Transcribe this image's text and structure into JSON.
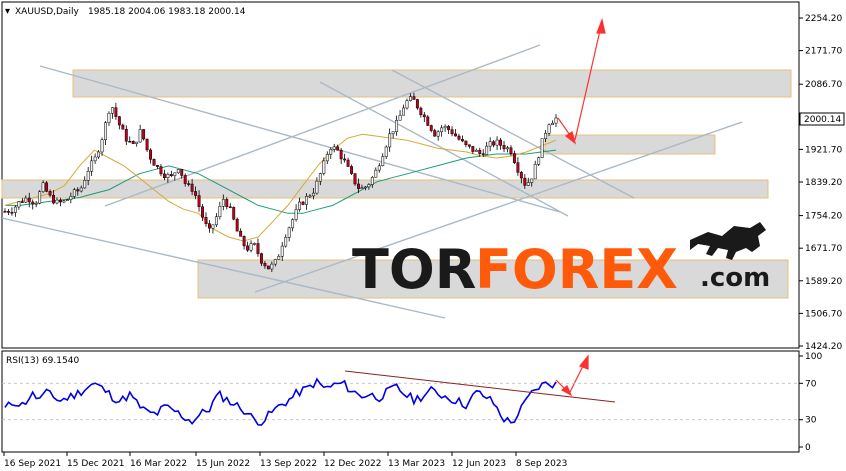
{
  "chart_data": [
    {
      "type": "candlestick",
      "title": "XAUUSD,Daily",
      "ohlc": "1985.18 2004.06 1983.18 2000.14",
      "last_price": "2000.14",
      "y_ticks": [
        "2254.20",
        "2171.70",
        "2086.70",
        "2004.20",
        "1921.70",
        "1839.20",
        "1754.20",
        "1671.70",
        "1589.20",
        "1506.70",
        "1424.20"
      ],
      "ylim": [
        1424.2,
        2254.2
      ],
      "x_ticks": [
        "16 Sep 2021",
        "15 Dec 2021",
        "16 Mar 2022",
        "15 Jun 2022",
        "13 Sep 2022",
        "12 Dec 2022",
        "13 Mar 2023",
        "12 Jun 2023",
        "8 Sep 2023"
      ],
      "path_y": [
        1765,
        1770,
        1790,
        1800,
        1785,
        1830,
        1800,
        1785,
        1790,
        1810,
        1820,
        1870,
        1900,
        1960,
        2040,
        1990,
        1950,
        1930,
        1970,
        1910,
        1880,
        1860,
        1850,
        1880,
        1830,
        1820,
        1760,
        1710,
        1750,
        1800,
        1760,
        1700,
        1670,
        1680,
        1640,
        1620,
        1640,
        1700,
        1740,
        1780,
        1800,
        1820,
        1870,
        1930,
        1920,
        1890,
        1850,
        1820,
        1830,
        1860,
        1910,
        1960,
        1990,
        2040,
        2050,
        2020,
        1990,
        1960,
        1980,
        1970,
        1950,
        1930,
        1920,
        1910,
        1930,
        1940,
        1930,
        1920,
        1870,
        1830,
        1860,
        1930,
        1990,
        2000
      ],
      "ma_slow": [
        1780,
        1780,
        1785,
        1790,
        1795,
        1800,
        1810,
        1820,
        1840,
        1860,
        1870,
        1880,
        1870,
        1860,
        1840,
        1820,
        1800,
        1780,
        1770,
        1760,
        1760,
        1770,
        1780,
        1800,
        1820,
        1840,
        1850,
        1860,
        1870,
        1880,
        1890,
        1900,
        1905,
        1910,
        1910,
        1910,
        1915,
        1920
      ],
      "ma_fast": [
        1780,
        1790,
        1800,
        1810,
        1830,
        1880,
        1920,
        1900,
        1880,
        1850,
        1820,
        1790,
        1770,
        1760,
        1720,
        1700,
        1690,
        1700,
        1740,
        1780,
        1830,
        1880,
        1920,
        1950,
        1960,
        1955,
        1950,
        1945,
        1935,
        1925,
        1920,
        1915,
        1905,
        1900,
        1905,
        1915,
        1930,
        1945
      ]
    },
    {
      "type": "line",
      "title": "RSI(13) 69.1540",
      "y_ticks": [
        "100",
        "70",
        "30",
        "0"
      ],
      "ylim": [
        0,
        100
      ],
      "values": [
        42,
        50,
        46,
        58,
        52,
        62,
        50,
        54,
        58,
        64,
        70,
        64,
        56,
        50,
        58,
        46,
        38,
        36,
        44,
        40,
        34,
        28,
        36,
        42,
        58,
        52,
        46,
        40,
        30,
        28,
        38,
        46,
        52,
        60,
        64,
        72,
        64,
        68,
        70,
        62,
        56,
        58,
        54,
        60,
        66,
        58,
        52,
        56,
        62,
        58,
        54,
        50,
        46,
        60,
        56,
        48,
        32,
        26,
        40,
        56,
        66,
        70,
        69
      ]
    }
  ],
  "logo": {
    "tor": "TOR",
    "forex": "FOREX",
    "com": ".com"
  },
  "colors": {
    "up": "#f0f0f0",
    "down": "#c0001a",
    "wick": "#000000",
    "ma_slow": "#1e9b78",
    "ma_fast": "#d7a93a",
    "rsi": "#0000e6",
    "rsi_trend": "#8b2020",
    "channel": "#a9b9c8",
    "zone_fill": "#d9d9d9",
    "zone_border": "#e8c07a",
    "arrow": "#ff3030"
  }
}
